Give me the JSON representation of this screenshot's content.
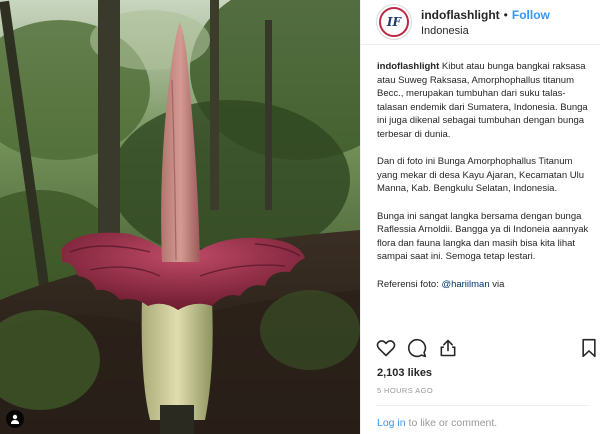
{
  "post": {
    "username": "indoflashlight",
    "avatar_text": "IF",
    "separator": "•",
    "follow_label": "Follow",
    "location": "Indonesia",
    "caption_user": "indoflashlight",
    "caption_first": "Kibut atau bunga bangkai raksasa atau Suweg Raksasa, Amorphophallus titanum Becc., merupakan tumbuhan dari suku talas-talasan endemik dari Sumatera, Indonesia. Bunga ini juga dikenal sebagai tumbuhan dengan bunga terbesar di dunia.",
    "caption_second": "Dan di foto ini Bunga Amorphophallus Titanum yang mekar di desa Kayu Ajaran, Kecamatan Ulu Manna, Kab. Bengkulu Selatan, Indonesia.",
    "caption_third": "Bunga ini sangat langka bersama dengan bunga Raflessia Arnoldii. Bangga ya di Indoneia aannyak flora dan fauna langka dan masih bisa kita lihat sampai saat ini. Semoga tetap lestari.",
    "credit_prefix": "Referensi foto:",
    "credit_mention": "@hariilman",
    "credit_suffix": "via",
    "likes": "2,103 likes",
    "timestamp": "5 HOURS AGO",
    "login_link": "Log in",
    "comment_rest": "to like or comment."
  },
  "icons": {
    "like": "heart-outline-icon",
    "comment": "speech-bubble-icon",
    "share": "share-arrow-icon",
    "save": "bookmark-icon",
    "tag": "person-tag-icon"
  },
  "colors": {
    "accent": "#3897f0",
    "flower_spathe": "#9a2f4a",
    "spadix": "#c98a86",
    "muted": "#999999"
  }
}
